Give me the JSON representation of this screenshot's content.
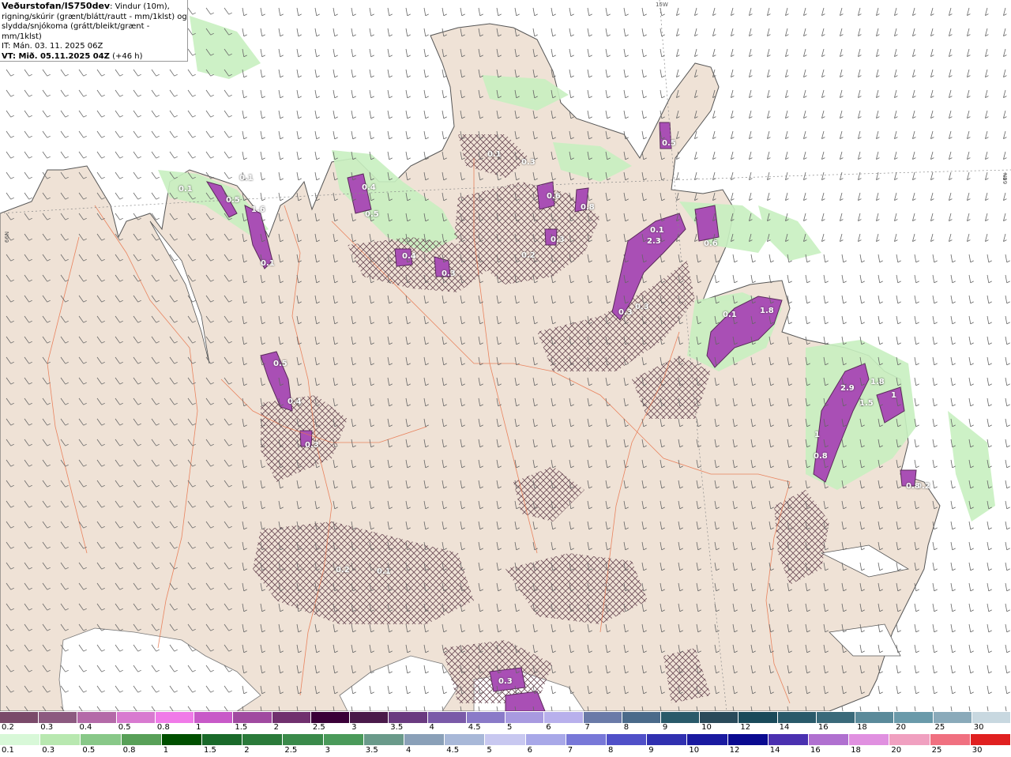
{
  "header": {
    "title": "Veðurstofan/IS750dev",
    "description_lines": [
      ": Vindur (10m),",
      "rigning/skúrir (grænt/blátt/rautt - mm/1klst) og",
      "slydda/snjókoma (grátt/bleikt/grænt - mm/1klst)"
    ],
    "it": "IT: Mán. 03. 11. 2025 06Z",
    "vt": "VT: Mið. 05.11.2025 04Z",
    "vt_offset": " (+46 h)"
  },
  "coords": {
    "lon_top": "15W",
    "lat_left": "66N",
    "lat_right": "66N"
  },
  "map_values": [
    "0.1",
    "0.5",
    "1.6",
    "0.1",
    "0.4",
    "0.5",
    "0.3",
    "0.6",
    "0.8",
    "0.3",
    "0.1",
    "0.5",
    "0.4",
    "0.3",
    "0.5",
    "0.4",
    "0.3",
    "0.1",
    "2.3",
    "0.3",
    "0.3",
    "0.1",
    "0.6",
    "0.1",
    "1.8",
    "1",
    "2.9",
    "1.8",
    "1.5",
    "1",
    "0.8",
    "0.2",
    "0.8",
    "0.3",
    "0.2",
    "0.1",
    "0.2"
  ],
  "legend": {
    "snow_labels": [
      "0.2",
      "0.3",
      "0.4",
      "0.5",
      "0.8",
      "1",
      "1.5",
      "2",
      "2.5",
      "3",
      "3.5",
      "4",
      "4.5",
      "5",
      "6",
      "7",
      "8",
      "9",
      "10",
      "12",
      "14",
      "16",
      "18",
      "20",
      "25",
      "30"
    ],
    "snow_colors": [
      "#7a4a6a",
      "#8c5a80",
      "#b46aa8",
      "#d87ad0",
      "#f07ae8",
      "#c85ac8",
      "#a04aa0",
      "#70306e",
      "#3a0038",
      "#4a1a4a",
      "#6a3a80",
      "#7a5aa8",
      "#8a7ac8",
      "#a89ae0",
      "#b8b0ec",
      "#6a7aa8",
      "#4a6a8a",
      "#2a5a6a",
      "#2a4a5a",
      "#1a4a5a",
      "#2a5a6a",
      "#3a6a7a",
      "#5a8a9a",
      "#6a9aaa",
      "#8aaaba",
      "#c8d8e0"
    ],
    "rain_labels": [
      "0.1",
      "0.3",
      "0.5",
      "0.8",
      "1",
      "1.5",
      "2",
      "2.5",
      "3",
      "3.5",
      "4",
      "4.5",
      "5",
      "6",
      "7",
      "8",
      "9",
      "10",
      "12",
      "14",
      "16",
      "18",
      "20",
      "25",
      "30"
    ],
    "rain_colors": [
      "#d8f8d8",
      "#b8e8b0",
      "#88c888",
      "#58a058",
      "#005000",
      "#1a6a2a",
      "#2a7a3a",
      "#3a8a4a",
      "#4a9a5a",
      "#6a9a8a",
      "#8aa0b8",
      "#a8b8d8",
      "#c8c8f0",
      "#a8a8e8",
      "#7878d8",
      "#5050c8",
      "#3030b0",
      "#1a1aa0",
      "#0a0a90",
      "#4a30b0",
      "#b070d0",
      "#e090e0",
      "#f0a0c0",
      "#f07080",
      "#e02020"
    ]
  }
}
